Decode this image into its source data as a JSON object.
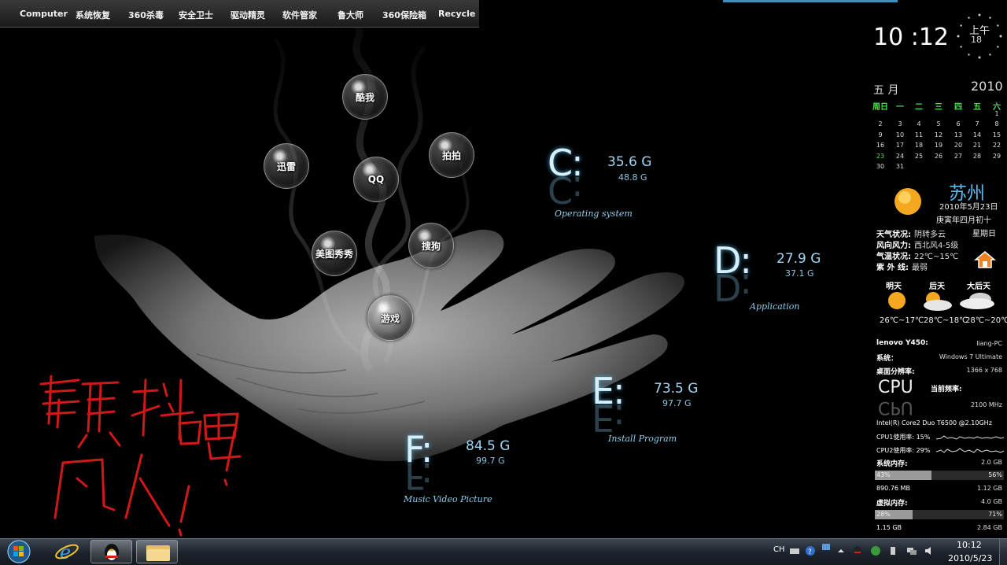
{
  "topbar": {
    "items": [
      "Computer",
      "系统恢复",
      "360杀毒",
      "安全卫士",
      "驱动精灵",
      "软件管家",
      "鲁大师",
      "360保险箱",
      "Recycle"
    ]
  },
  "bubbles": [
    "酷我",
    "迅雷",
    "QQ",
    "拍拍",
    "美图秀秀",
    "搜狗",
    "游戏"
  ],
  "drives": {
    "c": {
      "letter": "C:",
      "free": "35.6 G",
      "total": "48.8 G",
      "label": "Operating system"
    },
    "d": {
      "letter": "D:",
      "free": "27.9 G",
      "total": "37.1 G",
      "label": "Application"
    },
    "e": {
      "letter": "E:",
      "free": "73.5 G",
      "total": "97.7 G",
      "label": "Install Program"
    },
    "f": {
      "letter": "F:",
      "free": "84.5 G",
      "total": "99.7 G",
      "label": "Music Video Picture"
    }
  },
  "clock": {
    "time": "10 :12",
    "ampm": "上午",
    "seconds": "18"
  },
  "calendar": {
    "month": "五 月",
    "year": "2010",
    "weekdays": [
      "周日",
      "一",
      "二",
      "三",
      "四",
      "五",
      "六"
    ],
    "weeks": [
      [
        "",
        "",
        "",
        "",
        "",
        "",
        "1"
      ],
      [
        "2",
        "3",
        "4",
        "5",
        "6",
        "7",
        "8"
      ],
      [
        "9",
        "10",
        "11",
        "12",
        "13",
        "14",
        "15"
      ],
      [
        "16",
        "17",
        "18",
        "19",
        "20",
        "21",
        "22"
      ],
      [
        "23",
        "24",
        "25",
        "26",
        "27",
        "28",
        "29"
      ],
      [
        "30",
        "31",
        "",
        "",
        "",
        "",
        ""
      ]
    ],
    "today": "23"
  },
  "weather": {
    "city": "苏州",
    "date": "2010年5月23日",
    "lunar": "庚寅年四月初十",
    "weekday": "星期日",
    "rows": [
      {
        "k": "天气状况:",
        "v": "阴转多云"
      },
      {
        "k": "风向风力:",
        "v": "西北风4-5级"
      },
      {
        "k": "气温状况:",
        "v": "22℃~15℃"
      },
      {
        "k": "紫 外 线:",
        "v": "最弱"
      }
    ],
    "forecast": [
      {
        "day": "明天",
        "temp": "26℃~17℃"
      },
      {
        "day": "后天",
        "temp": "28℃~18℃"
      },
      {
        "day": "大后天",
        "temp": "28℃~20℃"
      }
    ]
  },
  "system": {
    "model": "lenovo Y450:",
    "host": "liang-PC",
    "os_label": "系统：",
    "os": "Windows 7 Ultimate",
    "res_label": "桌面分辨率:",
    "res": "1366 x 768",
    "cpu_logo": "CPU",
    "freq_label": "当前频率:",
    "freq": "2100 MHz",
    "cpu_name": "Intel(R) Core2 Duo T6500 @2.10GHz",
    "cpu1": "CPU1使用率: 15%",
    "cpu2": "CPU2使用率: 29%",
    "mem_label": "系统内存:",
    "mem_total": "2.0 GB",
    "mem_used_pct": "43%",
    "mem_free_pct": "56%",
    "mem_used_fraction": 0.44,
    "mem_used": "890.76 MB",
    "mem_free": "1.12 GB",
    "vmem_label": "虚拟内存:",
    "vmem_total": "4.0 GB",
    "vmem_used_pct": "28%",
    "vmem_free_pct": "71%",
    "vmem_used_fraction": 0.29,
    "vmem_used": "1.15 GB",
    "vmem_free": "2.84 GB"
  },
  "scribble": "颤抖吧!凡人!",
  "taskbar": {
    "lang": "CH",
    "time": "10:12",
    "date": "2010/5/23",
    "apps": [
      "start-orb-icon",
      "internet-explorer-icon",
      "qq-penguin-icon",
      "file-explorer-icon"
    ]
  },
  "colors": {
    "accent": "#5fb8ee",
    "drive_text": "#9fd6f2",
    "calendar_head": "#4ce04c",
    "scribble": "#d01818"
  }
}
